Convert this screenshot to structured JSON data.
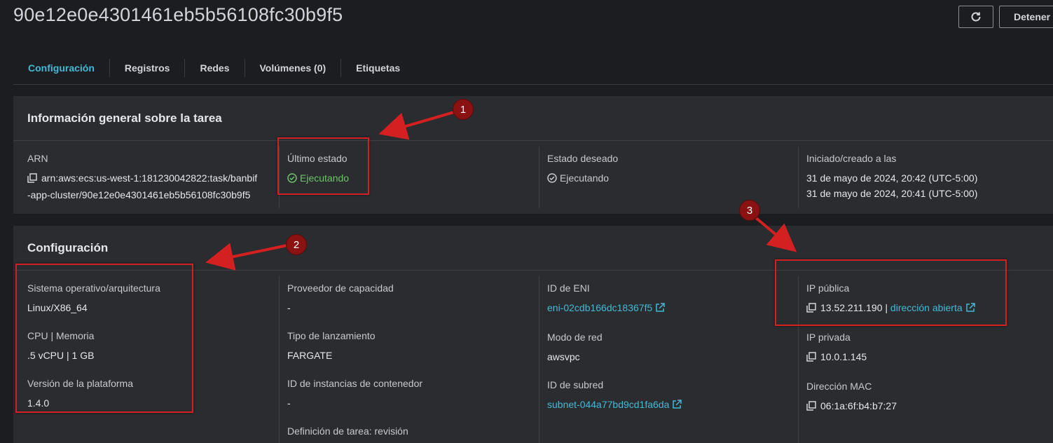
{
  "header": {
    "title": "90e12e0e4301461eb5b56108fc30b9f5",
    "stop_label": "Detener"
  },
  "tabs": [
    {
      "label": "Configuración"
    },
    {
      "label": "Registros"
    },
    {
      "label": "Redes"
    },
    {
      "label": "Volúmenes (0)"
    },
    {
      "label": "Etiquetas"
    }
  ],
  "overview": {
    "title": "Información general sobre la tarea",
    "arn_label": "ARN",
    "arn_line1": "arn:aws:ecs:us-west-1:181230042822:task/banbif",
    "arn_line2": "-app-cluster/90e12e0e4301461eb5b56108fc30b9f5",
    "last_status_label": "Último estado",
    "last_status_value": "Ejecutando",
    "desired_status_label": "Estado deseado",
    "desired_status_value": "Ejecutando",
    "started_label": "Iniciado/creado a las",
    "started_value": "31 de mayo de 2024, 20:42 (UTC-5:00)",
    "created_value": "31 de mayo de 2024, 20:41 (UTC-5:00)"
  },
  "config": {
    "title": "Configuración",
    "os_label": "Sistema operativo/arquitectura",
    "os_value": "Linux/X86_64",
    "cpu_label": "CPU | Memoria",
    "cpu_value": ".5 vCPU | 1 GB",
    "platform_label": "Versión de la plataforma",
    "platform_value": "1.4.0",
    "capacity_label": "Proveedor de capacidad",
    "capacity_value": "-",
    "launch_label": "Tipo de lanzamiento",
    "launch_value": "FARGATE",
    "container_label": "ID de instancias de contenedor",
    "container_value": "-",
    "taskdef_label": "Definición de tarea: revisión",
    "eni_label": "ID de ENI",
    "eni_value": "eni-02cdb166dc18367f5",
    "netmode_label": "Modo de red",
    "netmode_value": "awsvpc",
    "subnet_label": "ID de subred",
    "subnet_value": "subnet-044a77bd9cd1fa6da",
    "public_ip_label": "IP pública",
    "public_ip_value": "13.52.211.190",
    "public_ip_sep": "|",
    "open_address": "dirección abierta",
    "private_ip_label": "IP privada",
    "private_ip_value": "10.0.1.145",
    "mac_label": "Dirección MAC",
    "mac_value": "06:1a:6f:b4:b7:27"
  },
  "annotations": [
    "1",
    "2",
    "3"
  ],
  "colors": {
    "accent": "#44b9d6",
    "success": "#6fc26b",
    "annotation": "#d42020"
  }
}
